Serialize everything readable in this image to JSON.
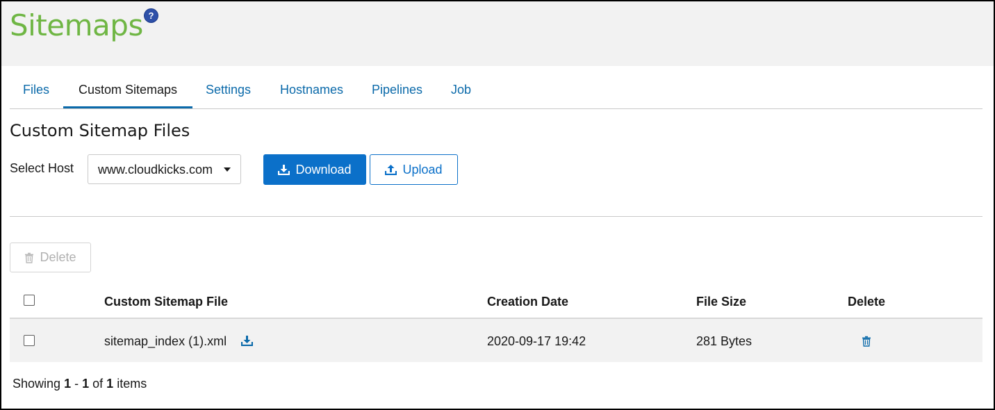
{
  "header": {
    "title": "Sitemaps",
    "help_symbol": "?"
  },
  "tabs": [
    {
      "label": "Files",
      "active": false
    },
    {
      "label": "Custom Sitemaps",
      "active": true
    },
    {
      "label": "Settings",
      "active": false
    },
    {
      "label": "Hostnames",
      "active": false
    },
    {
      "label": "Pipelines",
      "active": false
    },
    {
      "label": "Job",
      "active": false
    }
  ],
  "section": {
    "title": "Custom Sitemap Files",
    "host_label": "Select Host",
    "host_value": "www.cloudkicks.com",
    "download_label": "Download",
    "upload_label": "Upload",
    "delete_label": "Delete"
  },
  "table": {
    "columns": [
      "Custom Sitemap File",
      "Creation Date",
      "File Size",
      "Delete"
    ],
    "rows": [
      {
        "file": "sitemap_index (1).xml",
        "date": "2020-09-17 19:42",
        "size": "281 Bytes"
      }
    ]
  },
  "footer": {
    "showing": "Showing",
    "from": "1",
    "dash": "-",
    "to": "1",
    "of": "of",
    "total": "1",
    "items": "items"
  },
  "icons": {
    "help": "question-circle-icon",
    "download": "download-icon",
    "upload": "upload-icon",
    "delete": "trash-icon",
    "file_download": "download-icon",
    "row_delete": "trash-icon",
    "dropdown": "caret-down-icon"
  },
  "colors": {
    "brand_green": "#6fb644",
    "link_blue": "#0b6aaa",
    "primary_blue": "#0b70c9",
    "help_blue": "#2e50a8"
  }
}
